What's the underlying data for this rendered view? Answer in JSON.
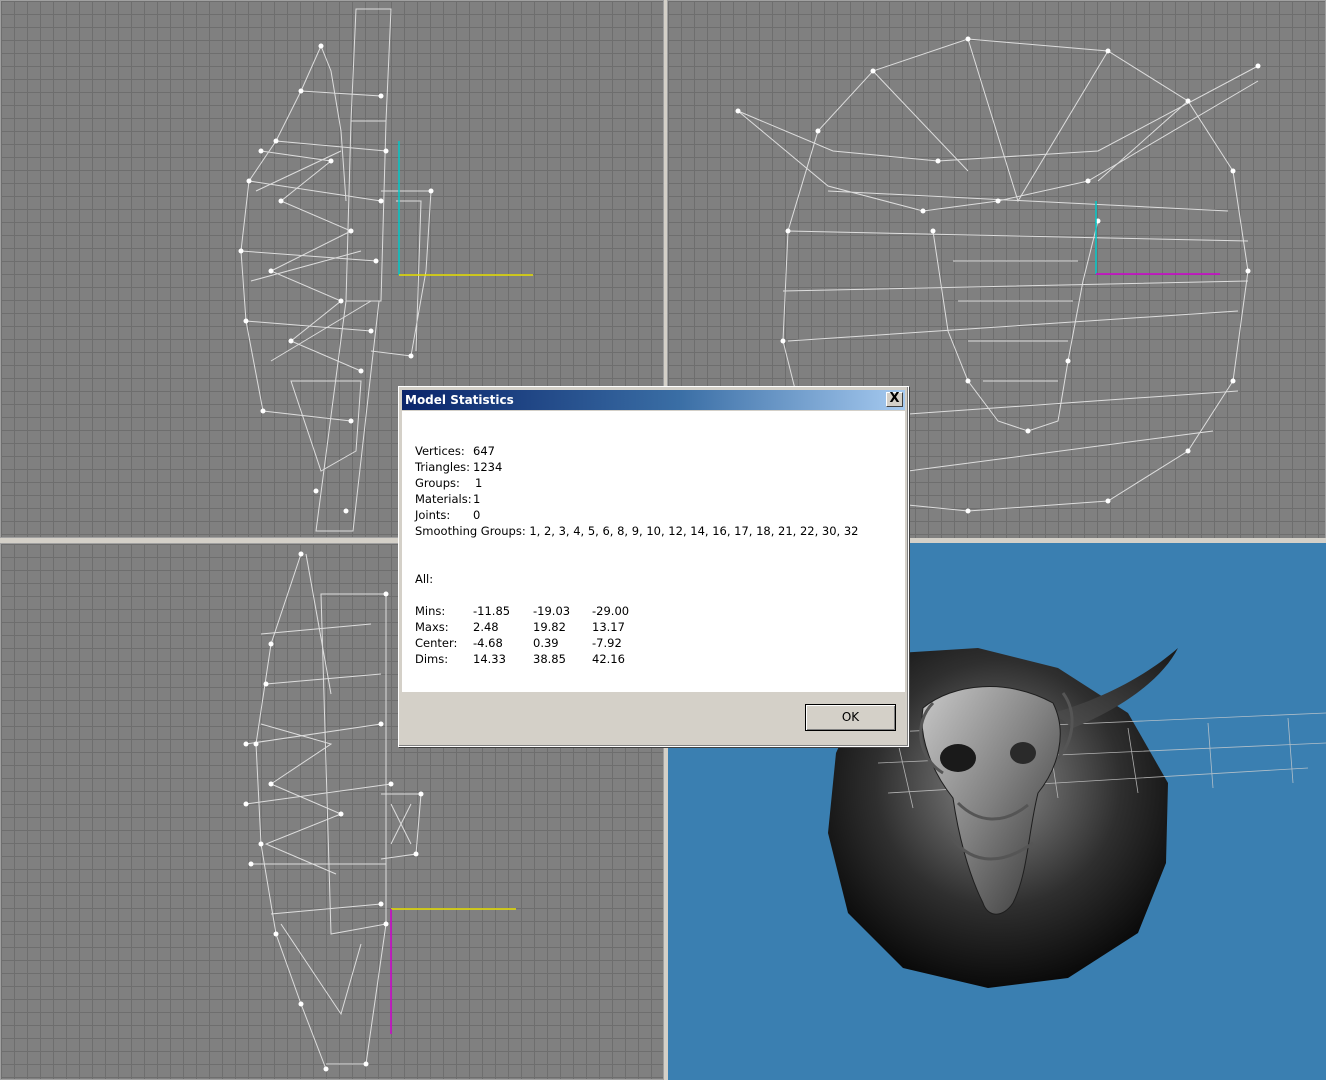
{
  "dialog": {
    "title": "Model Statistics",
    "close_label": "X",
    "ok_label": "OK",
    "stats": {
      "vertices_label": "Vertices:",
      "vertices_value": "647",
      "triangles_label": "Triangles:",
      "triangles_value": "1234",
      "groups_label": "Groups:",
      "groups_value": "1",
      "materials_label": "Materials:",
      "materials_value": "1",
      "joints_label": "Joints:",
      "joints_value": "0",
      "smoothing_label": "Smoothing Groups:",
      "smoothing_value": "1, 2, 3, 4, 5, 6, 8, 9, 10, 12, 14, 16, 17, 18, 21, 22, 30, 32",
      "all_label": "All:",
      "rows": [
        {
          "label": "Mins:",
          "x": "-11.85",
          "y": "-19.03",
          "z": "-29.00"
        },
        {
          "label": "Maxs:",
          "x": "2.48",
          "y": "19.82",
          "z": "13.17"
        },
        {
          "label": "Center:",
          "x": "-4.68",
          "y": "0.39",
          "z": "-7.92"
        },
        {
          "label": "Dims:",
          "x": "14.33",
          "y": "38.85",
          "z": "42.16"
        }
      ]
    }
  },
  "viewports": {
    "background_color": "#808080",
    "grid_color": "#6e6e6e",
    "perspective_background": "#3a7fb1",
    "wireframe_color": "#ffffff",
    "axis_colors": {
      "x": "#e8e000",
      "y": "#00c8c8",
      "z": "#d000d0"
    }
  }
}
